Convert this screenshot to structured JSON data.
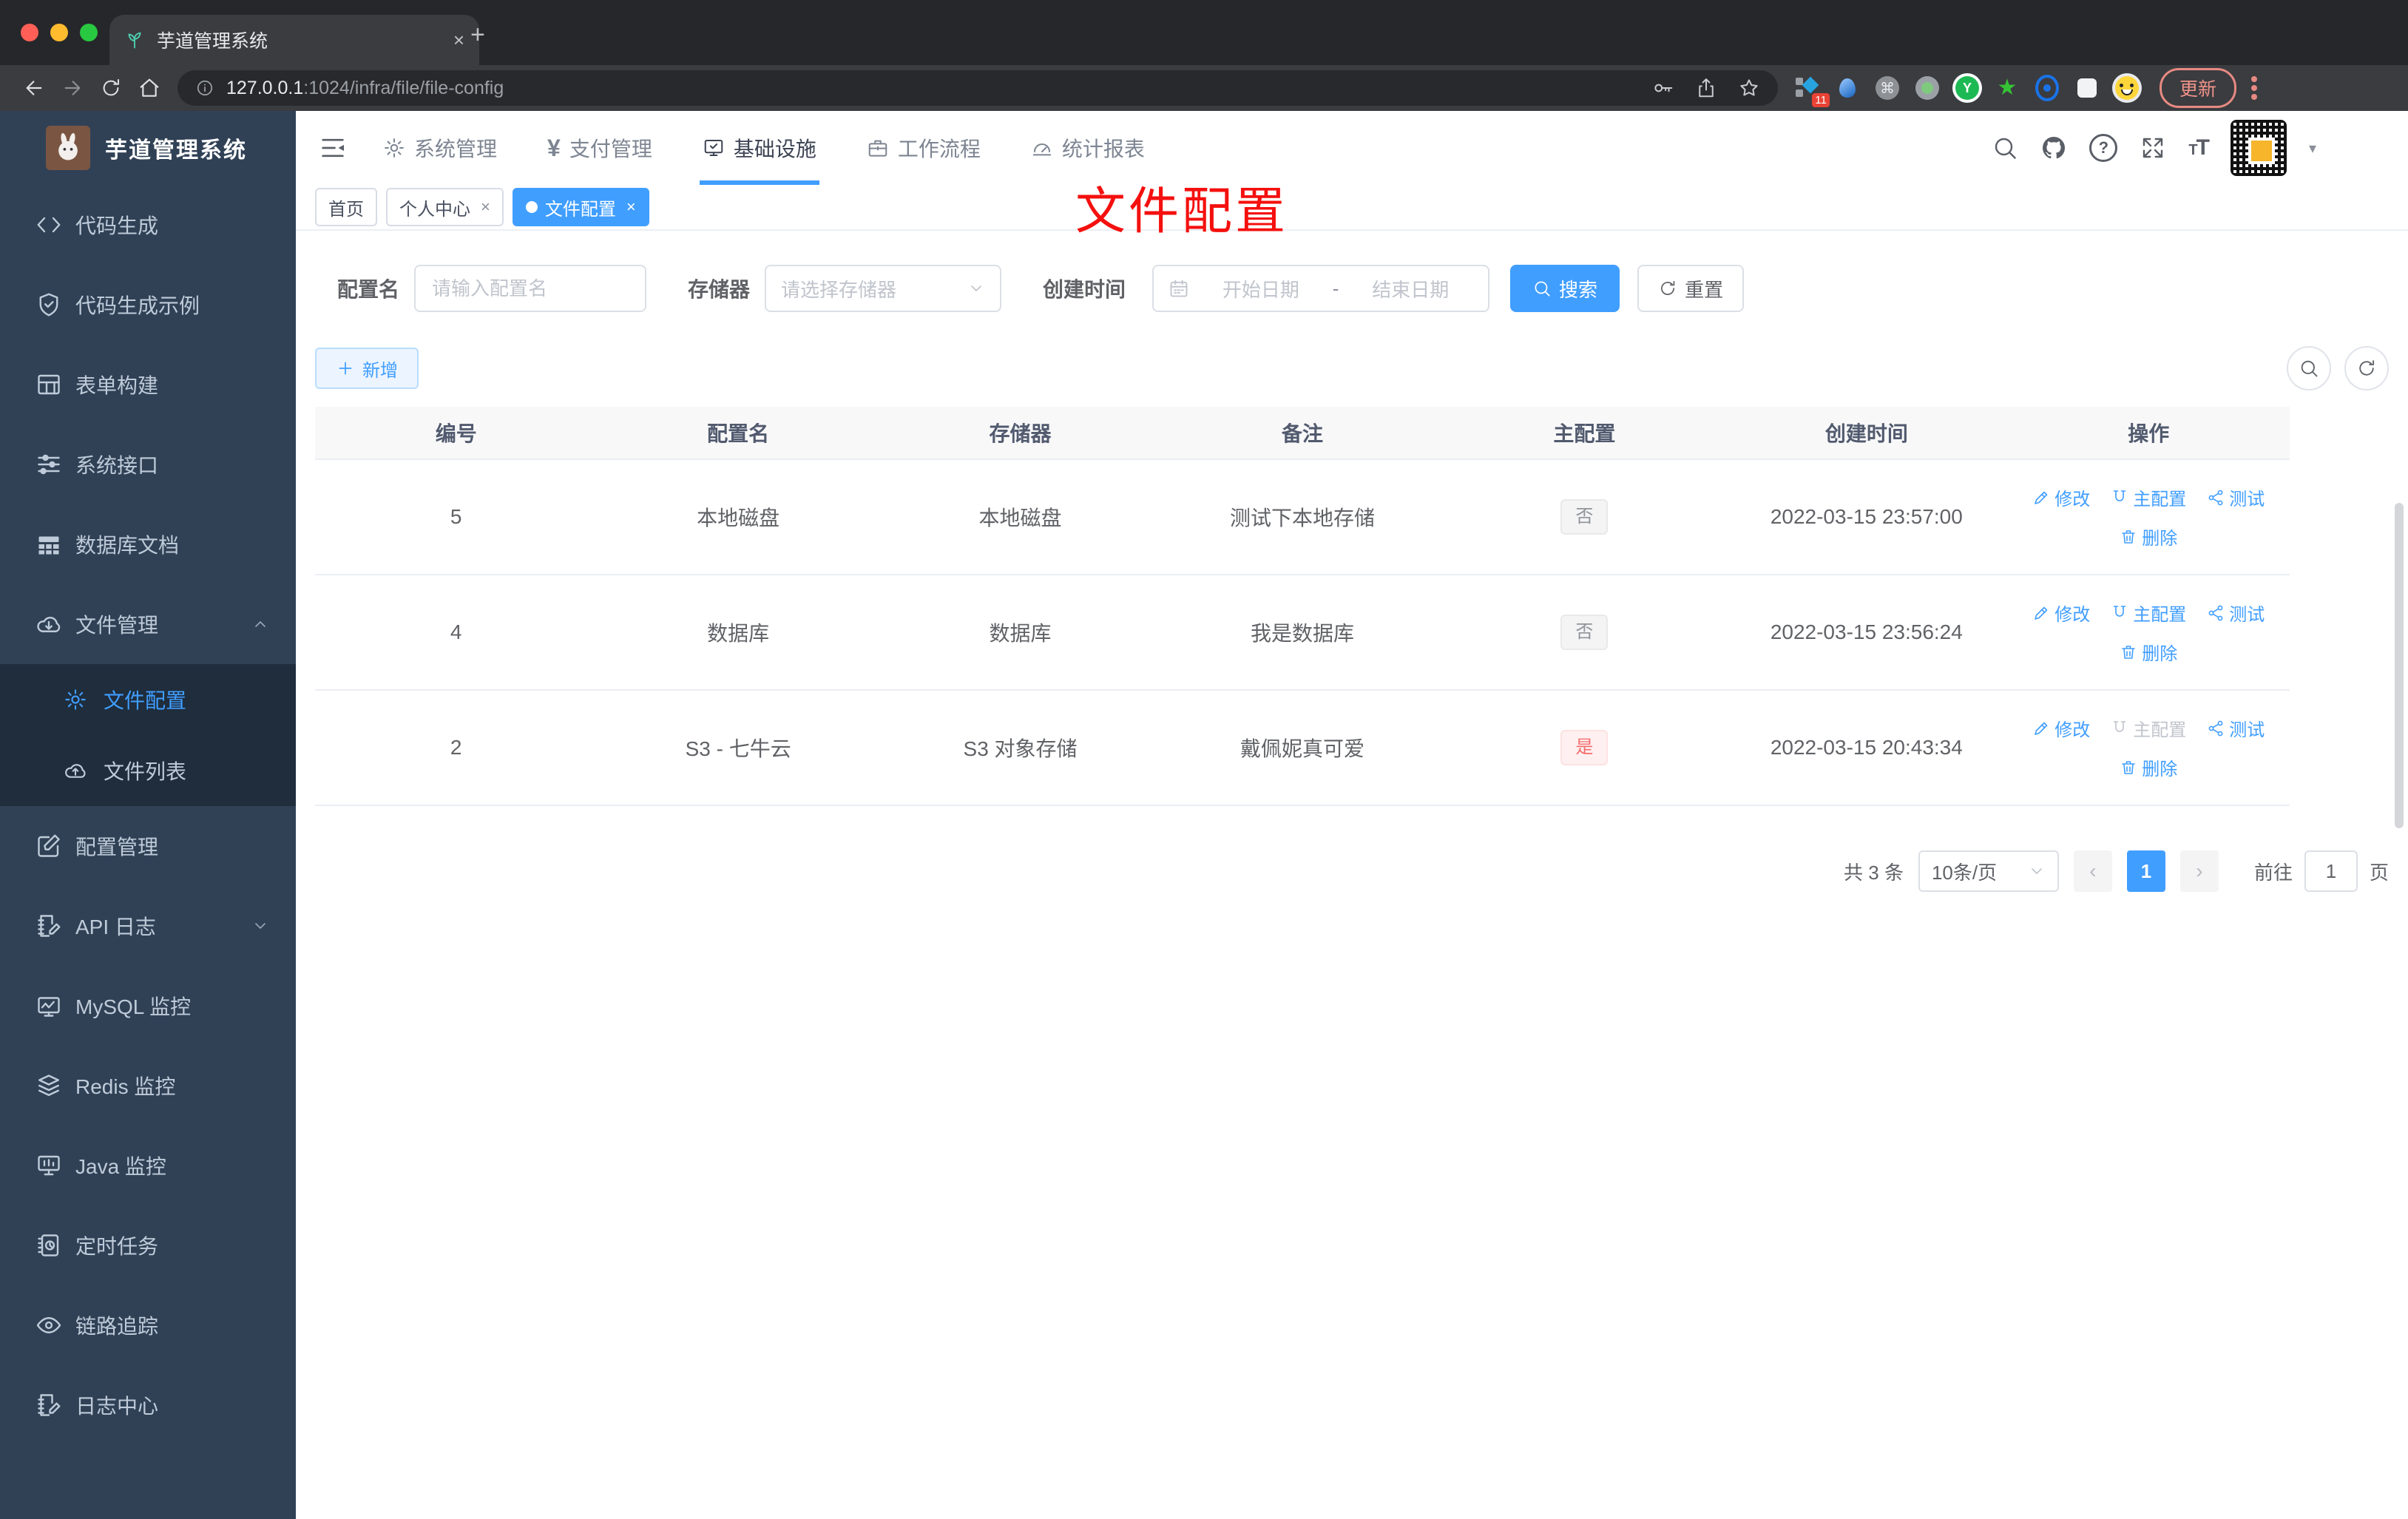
{
  "colors": {
    "primary": "#409eff",
    "danger": "#f56c6c",
    "sidebar_bg": "#304156",
    "annotation_red": "#f4100e"
  },
  "browser": {
    "tab_title": "芋道管理系统",
    "url_host": "127.0.0.1",
    "url_rest": ":1024/infra/file/file-config",
    "update_label": "更新",
    "ext_badge": "11"
  },
  "sidebar": {
    "app_title": "芋道管理系统",
    "items": [
      {
        "label": "代码生成",
        "icon": "code-icon"
      },
      {
        "label": "代码生成示例",
        "icon": "shield-check-icon"
      },
      {
        "label": "表单构建",
        "icon": "form-icon"
      },
      {
        "label": "系统接口",
        "icon": "sliders-icon"
      },
      {
        "label": "数据库文档",
        "icon": "table-icon"
      },
      {
        "label": "文件管理",
        "icon": "cloud-download-icon",
        "expanded": true
      },
      {
        "label": "配置管理",
        "icon": "edit-square-icon"
      },
      {
        "label": "API 日志",
        "icon": "doc-pencil-icon",
        "collapsible": true
      },
      {
        "label": "MySQL 监控",
        "icon": "chart-screen-icon"
      },
      {
        "label": "Redis 监控",
        "icon": "layers-icon"
      },
      {
        "label": "Java 监控",
        "icon": "monitor-icon"
      },
      {
        "label": "定时任务",
        "icon": "schedule-icon"
      },
      {
        "label": "链路追踪",
        "icon": "eye-icon"
      },
      {
        "label": "日志中心",
        "icon": "log-edit-icon"
      }
    ],
    "submenu": [
      {
        "label": "文件配置",
        "icon": "gear-icon",
        "active": true
      },
      {
        "label": "文件列表",
        "icon": "cloud-upload-icon"
      }
    ]
  },
  "topnav": {
    "items": [
      {
        "label": "系统管理",
        "icon": "gear-icon"
      },
      {
        "label": "支付管理",
        "icon": "yen-icon"
      },
      {
        "label": "基础设施",
        "icon": "infra-monitor-icon",
        "active": true
      },
      {
        "label": "工作流程",
        "icon": "briefcase-icon"
      },
      {
        "label": "统计报表",
        "icon": "dashboard-icon"
      }
    ]
  },
  "tabs": [
    {
      "label": "首页"
    },
    {
      "label": "个人中心",
      "closable": true
    },
    {
      "label": "文件配置",
      "active": true,
      "closable": true
    }
  ],
  "annotation": {
    "text": "文件配置"
  },
  "filters": {
    "name_label": "配置名",
    "name_placeholder": "请输入配置名",
    "storage_label": "存储器",
    "storage_placeholder": "请选择存储器",
    "time_label": "创建时间",
    "start_placeholder": "开始日期",
    "range_separator": "-",
    "end_placeholder": "结束日期",
    "search_label": "搜索",
    "reset_label": "重置"
  },
  "toolbar": {
    "add_label": "新增"
  },
  "table": {
    "columns": [
      "编号",
      "配置名",
      "存储器",
      "备注",
      "主配置",
      "创建时间",
      "操作"
    ],
    "rows": [
      {
        "id": "5",
        "name": "本地磁盘",
        "storage": "本地磁盘",
        "remark": "测试下本地存储",
        "primary": "否",
        "primary_type": "info",
        "created": "2022-03-15 23:57:00",
        "primary_action_disabled": false
      },
      {
        "id": "4",
        "name": "数据库",
        "storage": "数据库",
        "remark": "我是数据库",
        "primary": "否",
        "primary_type": "info",
        "created": "2022-03-15 23:56:24",
        "primary_action_disabled": false
      },
      {
        "id": "2",
        "name": "S3 - 七牛云",
        "storage": "S3 对象存储",
        "remark": "戴佩妮真可爱",
        "primary": "是",
        "primary_type": "danger",
        "created": "2022-03-15 20:43:34",
        "primary_action_disabled": true
      }
    ]
  },
  "row_actions": {
    "edit": "修改",
    "primary": "主配置",
    "test": "测试",
    "remove": "删除"
  },
  "pagination": {
    "total": "共 3 条",
    "size": "10条/页",
    "page": "1",
    "goto_label": "前往",
    "goto_value": "1",
    "page_unit": "页"
  }
}
